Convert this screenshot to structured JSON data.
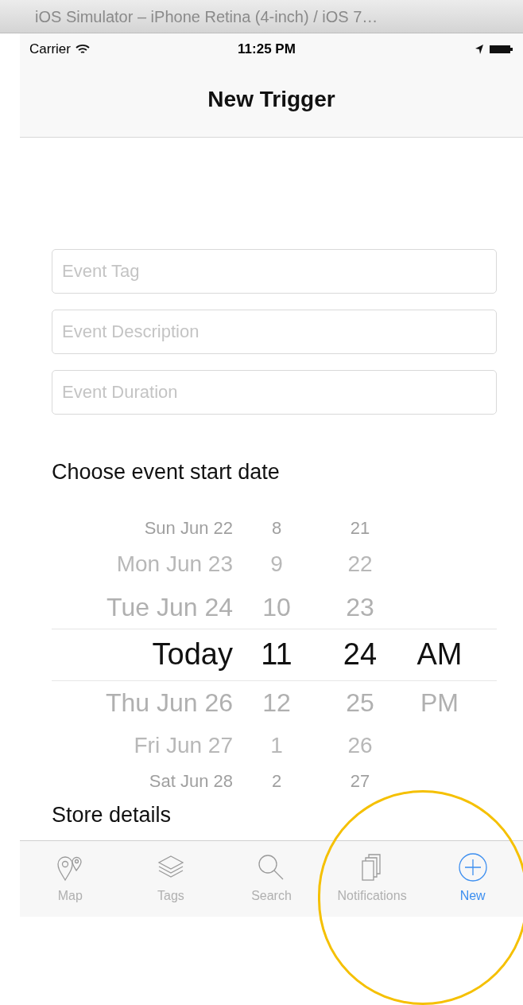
{
  "window": {
    "title": "iOS Simulator – iPhone Retina (4-inch) / iOS 7…"
  },
  "status_bar": {
    "carrier": "Carrier",
    "time": "11:25 PM"
  },
  "nav_bar": {
    "title": "New Trigger"
  },
  "fields": [
    {
      "placeholder": "Event Tag"
    },
    {
      "placeholder": "Event Description"
    },
    {
      "placeholder": "Event Duration"
    }
  ],
  "date_label": "Choose event start date",
  "picker": {
    "rows": [
      {
        "date": "Sun Jun 22",
        "hour": "8",
        "minute": "21",
        "selected": false
      },
      {
        "date": "Mon Jun 23",
        "hour": "9",
        "minute": "22",
        "selected": false
      },
      {
        "date": "Tue Jun 24",
        "hour": "10",
        "minute": "23",
        "selected": false
      },
      {
        "date": "Today",
        "hour": "11",
        "minute": "24",
        "ampm": "AM",
        "selected": true
      },
      {
        "date": "Thu Jun 26",
        "hour": "12",
        "minute": "25",
        "ampm": "PM",
        "selected": false
      },
      {
        "date": "Fri Jun 27",
        "hour": "1",
        "minute": "26",
        "selected": false
      },
      {
        "date": "Sat Jun 28",
        "hour": "2",
        "minute": "27",
        "selected": false
      }
    ]
  },
  "store_label": "Store details",
  "tab_bar": [
    {
      "kind": "map",
      "label": "Map",
      "selected": false
    },
    {
      "kind": "tags",
      "label": "Tags",
      "selected": false
    },
    {
      "kind": "search",
      "label": "Search",
      "selected": false
    },
    {
      "kind": "notifications",
      "label": "Notifications",
      "selected": false
    },
    {
      "kind": "new",
      "label": "New",
      "selected": true
    }
  ]
}
